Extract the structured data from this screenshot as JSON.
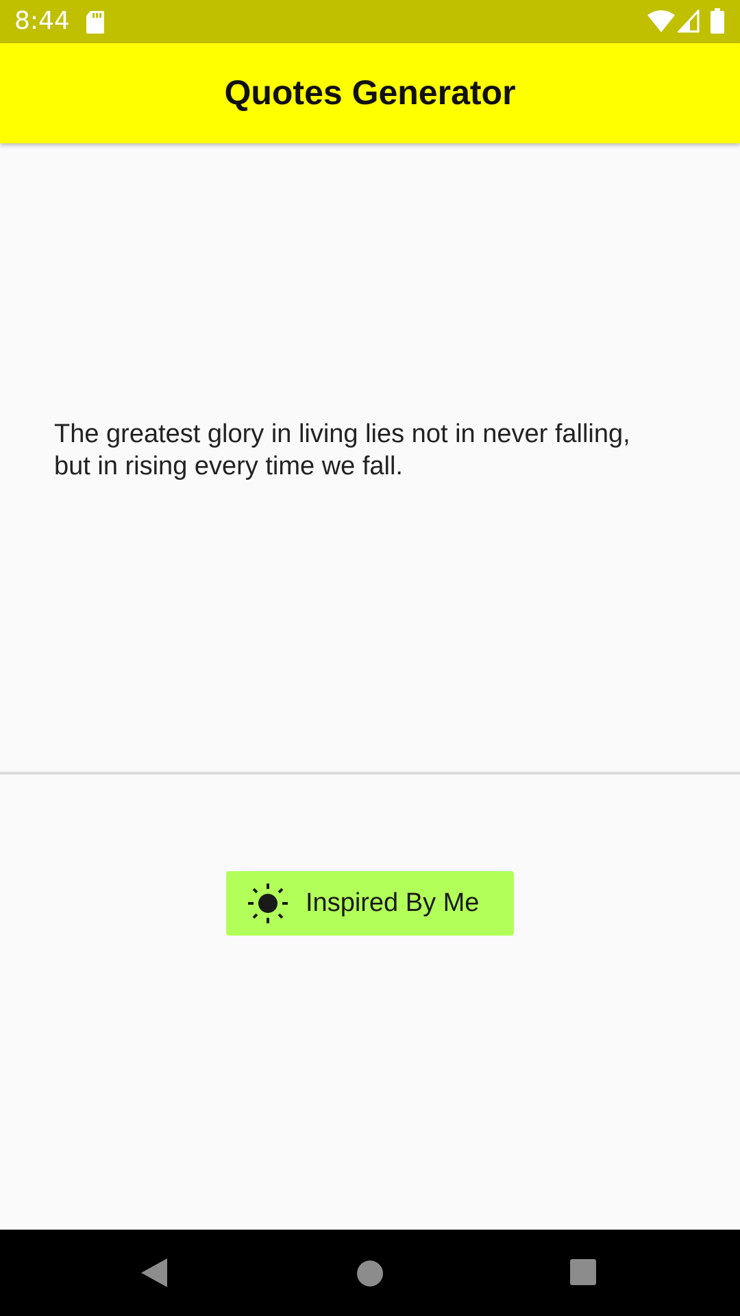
{
  "status_bar": {
    "time": "8:44",
    "icons": [
      "sd-card-icon",
      "wifi-icon",
      "cell-signal-icon",
      "battery-icon"
    ]
  },
  "app_bar": {
    "title": "Quotes Generator"
  },
  "quote": {
    "text": "The greatest glory in living lies not in never falling, but in rising every time we fall."
  },
  "action_button": {
    "label": "Inspired By Me",
    "icon": "sun-icon"
  },
  "nav_bar": {
    "icons": [
      "back-icon",
      "home-icon",
      "recents-icon"
    ]
  },
  "colors": {
    "status_bar": "#c0c000",
    "app_bar": "#ffff00",
    "background": "#fafafa",
    "button": "#b2ff59",
    "nav_bar": "#000000"
  }
}
